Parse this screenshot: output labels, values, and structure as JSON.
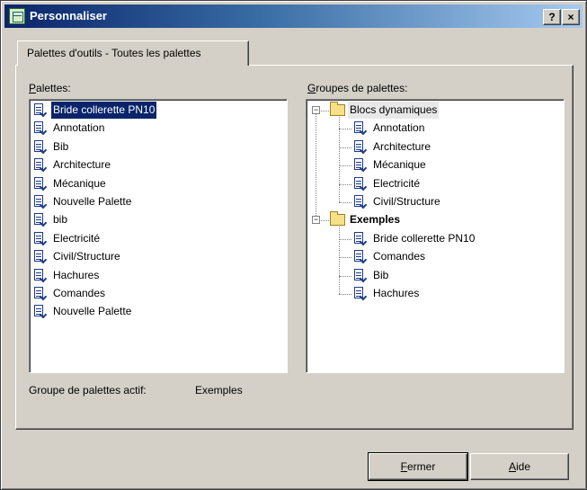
{
  "window": {
    "title": "Personnaliser",
    "help_btn": "?",
    "close_btn": "×"
  },
  "tab": {
    "label": "Palettes d'outils - Toutes les palettes"
  },
  "palettes": {
    "label": "Palettes:",
    "label_accel": "P",
    "label_rest": "alettes:",
    "items": [
      "Bride collerette PN10",
      "Annotation",
      "Bib",
      "Architecture",
      "Mécanique",
      "Nouvelle Palette",
      "bib",
      "Electricité",
      "Civil/Structure",
      "Hachures",
      "Comandes",
      "Nouvelle Palette"
    ],
    "selected_index": 0
  },
  "groups": {
    "label": "Groupes de palettes:",
    "label_accel": "G",
    "label_rest": "roupes de palettes:",
    "tree": [
      {
        "name": "Blocs dynamiques",
        "expanded": true,
        "bold": false,
        "children": [
          "Annotation",
          "Architecture",
          "Mécanique",
          "Electricité",
          "Civil/Structure"
        ]
      },
      {
        "name": "Exemples",
        "expanded": true,
        "bold": true,
        "children": [
          "Bride collerette PN10",
          "Comandes",
          "Bib",
          "Hachures"
        ]
      }
    ]
  },
  "active_group": {
    "label": "Groupe de palettes actif:",
    "value": "Exemples"
  },
  "buttons": {
    "close_accel": "F",
    "close_rest": "ermer",
    "help_accel": "A",
    "help_rest": "ide"
  },
  "colors": {
    "selection": "#0a246a",
    "face": "#d4d0c8",
    "folder": "#f8e08a"
  }
}
